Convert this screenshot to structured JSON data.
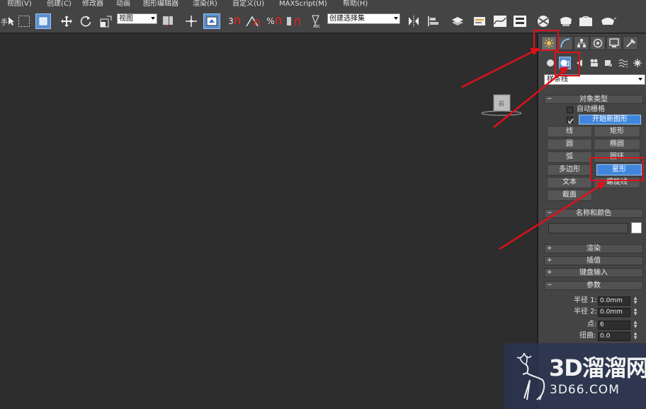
{
  "menubar": {
    "items": [
      "视图(V)",
      "创建(C)",
      "修改器",
      "动画",
      "图形编辑器",
      "渲染(R)",
      "自定义(U)",
      "MAXScript(M)",
      "帮助(H)"
    ]
  },
  "toolbar": {
    "left_fragment": "手",
    "view_dropdown": "视图",
    "snap_3": "3",
    "snap_percent": "%",
    "named_selection": "创建选择集"
  },
  "panel": {
    "category": "样条线",
    "object_type": {
      "title": "对象类型",
      "auto_grid": "自动栅格",
      "start_new_shape": "开始新图形",
      "buttons": [
        {
          "label": "线"
        },
        {
          "label": "矩形"
        },
        {
          "label": "圆"
        },
        {
          "label": "椭圆"
        },
        {
          "label": "弧"
        },
        {
          "label": "圆环"
        },
        {
          "label": "多边形"
        },
        {
          "label": "星形"
        },
        {
          "label": "文本"
        },
        {
          "label": "螺旋线"
        },
        {
          "label": "截面"
        }
      ]
    },
    "name_color": {
      "title": "名称和颜色"
    },
    "collapsed": [
      "渲染",
      "插值",
      "键盘输入"
    ],
    "params": {
      "title": "参数",
      "radius1_label": "半径 1:",
      "radius1_value": "0.0mm",
      "radius2_label": "半径 2:",
      "radius2_value": "0.0mm",
      "points_label": "点:",
      "points_value": "6",
      "distortion_label": "扭曲:",
      "distortion_value": "0.0"
    }
  },
  "viewport": {
    "teapot_label": "前"
  },
  "watermark": {
    "title": "3D溜溜网",
    "sub": "3D66.COM"
  },
  "colors": {
    "annotation": "#e0101a",
    "selected": "#3f86dc"
  }
}
